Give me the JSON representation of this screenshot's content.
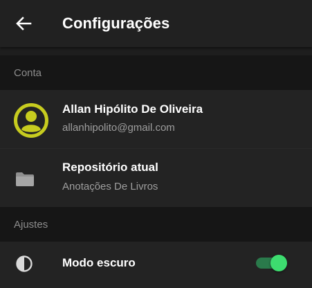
{
  "appbar": {
    "title": "Configurações",
    "back_icon": "arrow-left-icon"
  },
  "sections": {
    "conta": {
      "label": "Conta"
    },
    "ajustes": {
      "label": "Ajustes"
    }
  },
  "account": {
    "name": "Allan Hipólito De Oliveira",
    "email": "allanhipolito@gmail.com",
    "icon": "account-circle-icon",
    "icon_color": "#c7cc1f"
  },
  "repository": {
    "label": "Repositório atual",
    "value": "Anotações De Livros",
    "icon": "folder-icon"
  },
  "dark_mode": {
    "label": "Modo escuro",
    "icon": "contrast-icon",
    "enabled": true,
    "toggle_color": "#3ddc6f"
  },
  "colors": {
    "background": "#1e1e1e",
    "appbar": "#212121",
    "section_header": "#161616",
    "row": "#232323",
    "secondary_text": "#9e9e9e"
  }
}
